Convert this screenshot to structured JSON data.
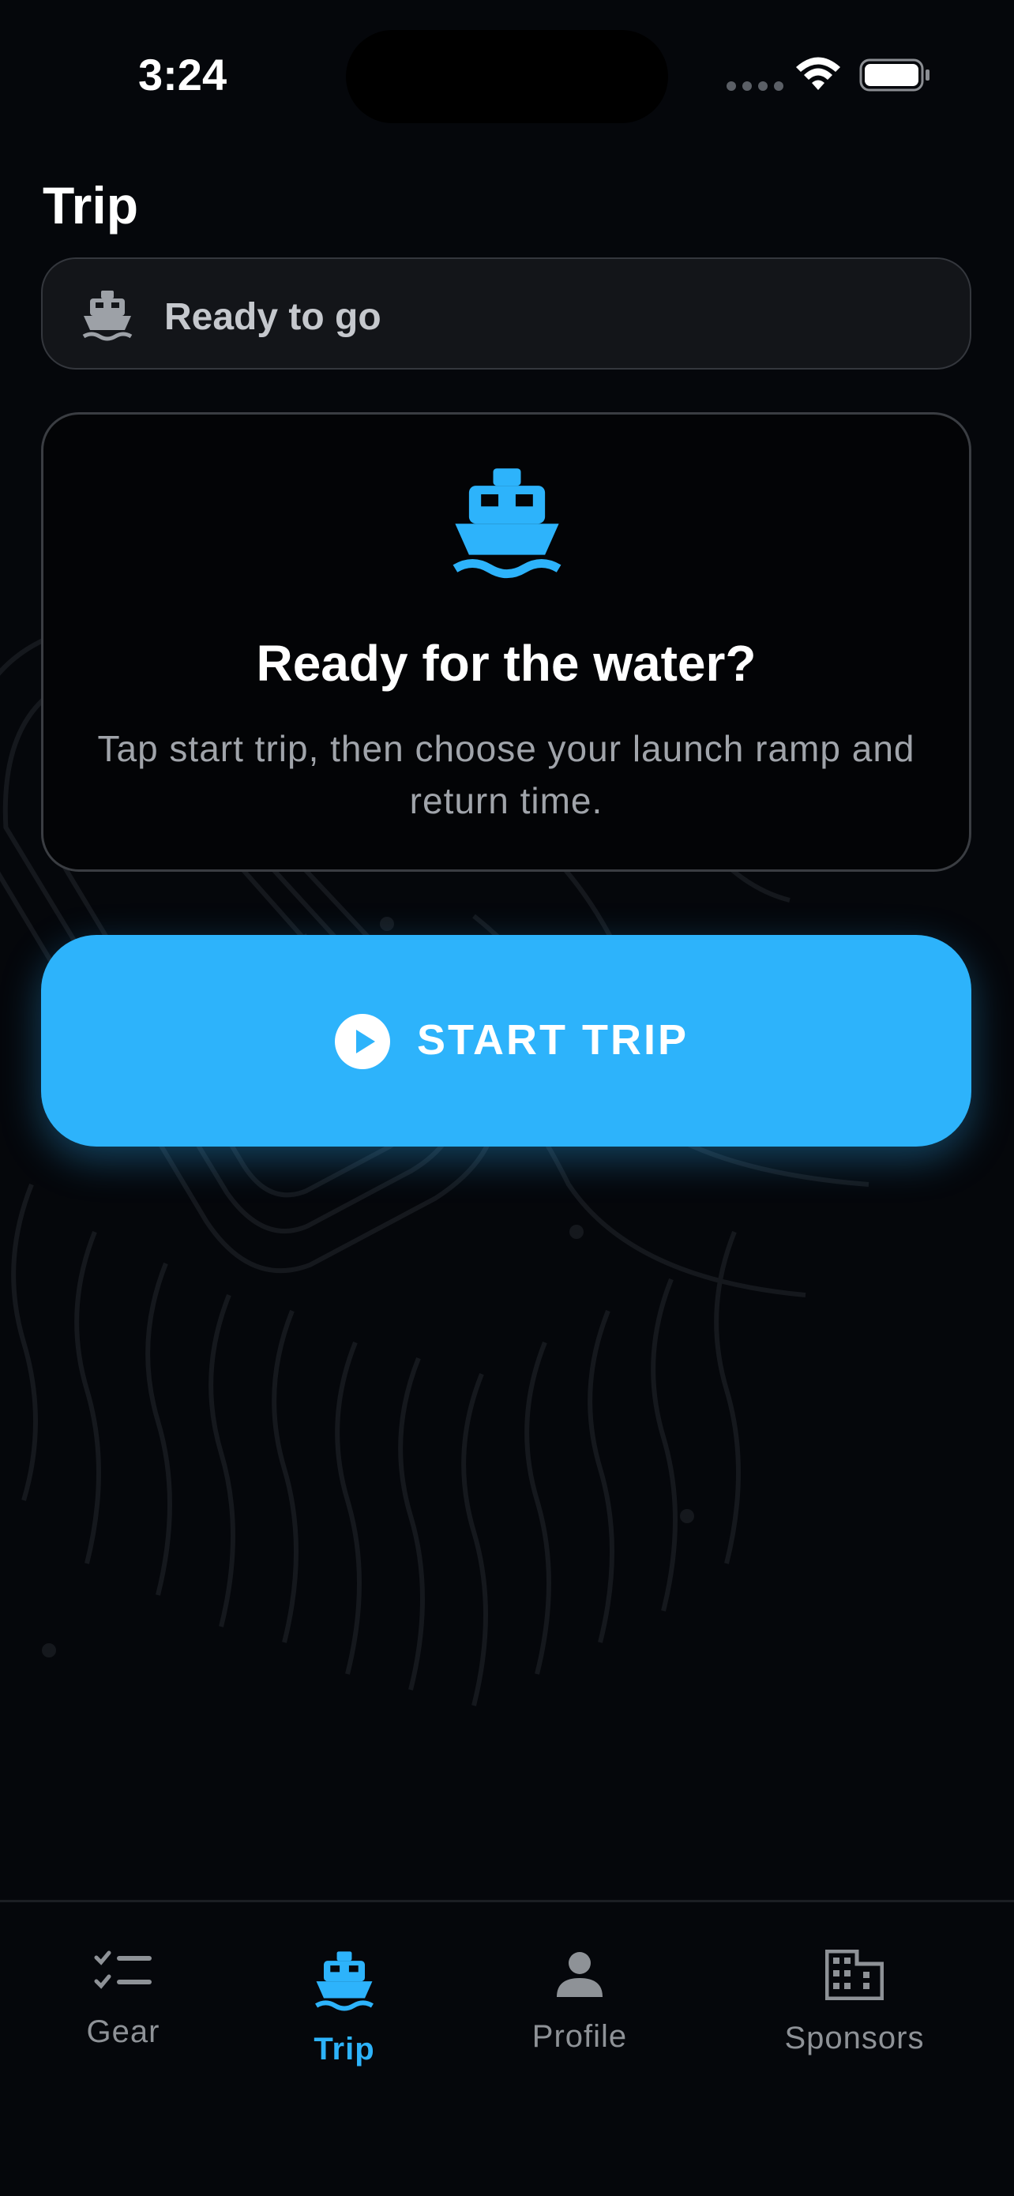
{
  "status_bar": {
    "time": "3:24"
  },
  "page": {
    "title": "Trip"
  },
  "status_pill": {
    "label": "Ready to go",
    "icon": "boat-icon"
  },
  "card": {
    "icon": "boat-icon",
    "title": "Ready for the water?",
    "body": "Tap start trip, then choose your launch ramp and return time."
  },
  "start_button": {
    "label": "START TRIP",
    "icon": "play-circle-icon"
  },
  "tabs": [
    {
      "label": "Gear",
      "icon": "checklist-icon",
      "active": false
    },
    {
      "label": "Trip",
      "icon": "boat-icon",
      "active": true
    },
    {
      "label": "Profile",
      "icon": "person-icon",
      "active": false
    },
    {
      "label": "Sponsors",
      "icon": "building-icon",
      "active": false
    }
  ],
  "colors": {
    "accent": "#2db3fb",
    "background": "#05070b",
    "inactive": "#8e9297"
  }
}
